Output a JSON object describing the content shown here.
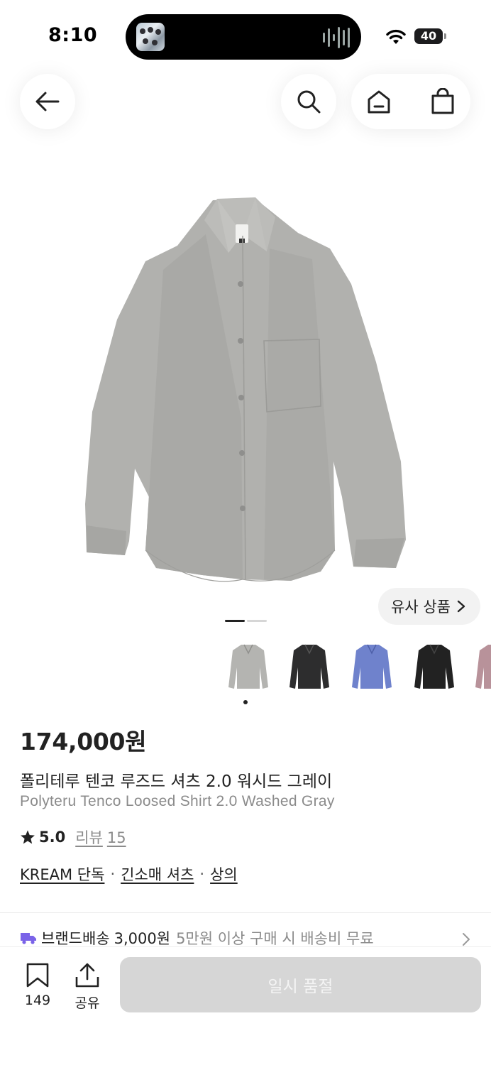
{
  "status_bar": {
    "time": "8:10",
    "battery": "40"
  },
  "product": {
    "price": "174,000원",
    "name_ko": "폴리테루 텐코 루즈드 셔츠 2.0 워시드 그레이",
    "name_en": "Polyteru Tenco Loosed Shirt 2.0 Washed Gray",
    "image_icon": "gray-shirt-image",
    "rating": "5.0",
    "review_label": "리뷰",
    "review_count": "15"
  },
  "similar_button": {
    "label": "유사 상품"
  },
  "thumbnails": [
    {
      "name": "thumb-gray-shirt",
      "color": "#b4b4b1"
    },
    {
      "name": "thumb-charcoal-shirt",
      "color": "#2d2d2e"
    },
    {
      "name": "thumb-blue-shirt",
      "color": "#6f82cc"
    },
    {
      "name": "thumb-black-shirt",
      "color": "#222222"
    },
    {
      "name": "thumb-mauve-shirt",
      "color": "#b8929a"
    }
  ],
  "tags": [
    {
      "label": "KREAM 단독"
    },
    {
      "label": "긴소매 셔츠"
    },
    {
      "label": "상의"
    }
  ],
  "tag_separator": "·",
  "shipping": {
    "label": "브랜드배송",
    "fee": "3,000원",
    "note": "5만원 이상 구매 시 배송비 무료"
  },
  "bottom_bar": {
    "bookmark_count": "149",
    "share_label": "공유",
    "action_label": "일시 품절"
  },
  "colors": {
    "truck_accent": "#7a63e8",
    "soldout_bg": "#d6d6d6"
  }
}
